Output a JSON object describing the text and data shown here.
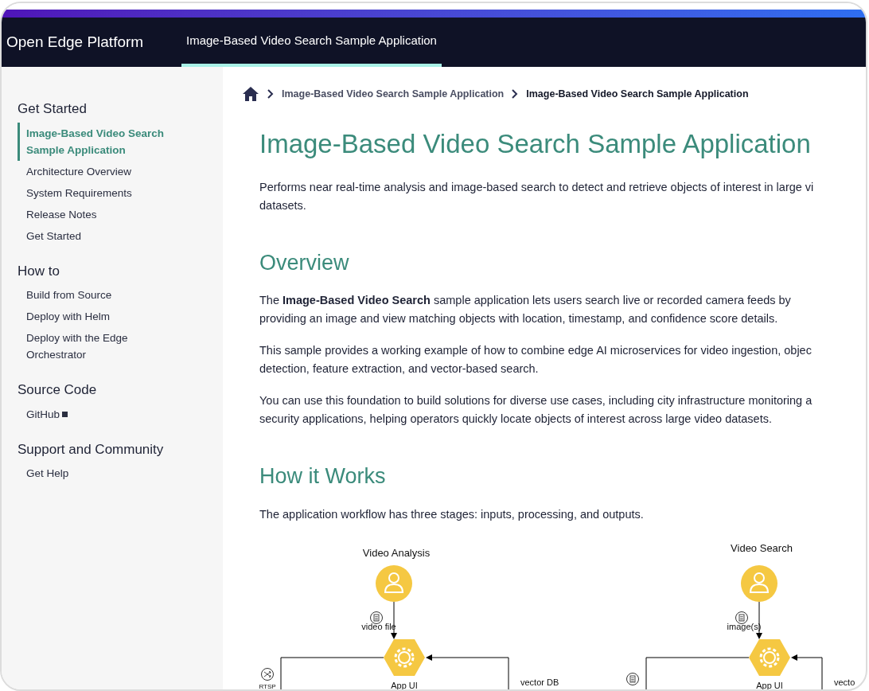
{
  "header": {
    "brand": "Open Edge Platform",
    "tabs": [
      {
        "label": "Image-Based Video Search Sample Application",
        "selected": true
      }
    ]
  },
  "sidebar": {
    "sections": [
      {
        "title": "Get Started",
        "items": [
          {
            "label": "Image-Based Video Search Sample Application",
            "selected": true,
            "external": false
          },
          {
            "label": "Architecture Overview",
            "selected": false,
            "external": false
          },
          {
            "label": "System Requirements",
            "selected": false,
            "external": false
          },
          {
            "label": "Release Notes",
            "selected": false,
            "external": false
          },
          {
            "label": "Get Started",
            "selected": false,
            "external": false
          }
        ]
      },
      {
        "title": "How to",
        "items": [
          {
            "label": "Build from Source",
            "selected": false,
            "external": false
          },
          {
            "label": "Deploy with Helm",
            "selected": false,
            "external": false
          },
          {
            "label": "Deploy with the Edge Orchestrator",
            "selected": false,
            "external": false
          }
        ]
      },
      {
        "title": "Source Code",
        "items": [
          {
            "label": "GitHub",
            "selected": false,
            "external": true
          }
        ]
      },
      {
        "title": "Support and Community",
        "items": [
          {
            "label": "Get Help",
            "selected": false,
            "external": false
          }
        ]
      }
    ]
  },
  "breadcrumb": [
    {
      "label": "Image-Based Video Search Sample Application",
      "current": false
    },
    {
      "label": "Image-Based Video Search Sample Application",
      "current": true
    }
  ],
  "content": [
    {
      "kind": "h1",
      "text": "Image-Based Video Search Sample Application"
    },
    {
      "kind": "p",
      "lines": [
        "Performs near real-time analysis and image-based search to detect and retrieve objects of interest in large vi",
        "datasets."
      ]
    },
    {
      "kind": "h2",
      "text": "Overview"
    },
    {
      "kind": "p",
      "lines": [
        "The **Image-Based Video Search** sample application lets users search live or recorded camera feeds by",
        "providing an image and view matching objects with location, timestamp, and confidence score details."
      ]
    },
    {
      "kind": "p",
      "lines": [
        "This sample provides a working example of how to combine edge AI microservices for video ingestion, objec",
        "detection, feature extraction, and vector-based search."
      ]
    },
    {
      "kind": "p",
      "lines": [
        "You can use this foundation to build solutions for diverse use cases, including city infrastructure monitoring a",
        "security applications, helping operators quickly locate objects of interest across large video datasets."
      ]
    },
    {
      "kind": "h2",
      "text": "How it Works"
    },
    {
      "kind": "p",
      "lines": [
        "The application workflow has three stages: inputs, processing, and outputs."
      ]
    }
  ],
  "diagram": {
    "panels": [
      {
        "title": "Video Analysis",
        "input_label": "video file",
        "node_label": "App UI",
        "left_port": {
          "kind": "shuffle",
          "label": "RTSP"
        },
        "right_label": "vector DB"
      },
      {
        "title": "Video Search",
        "input_label": "image(s)",
        "node_label": "App UI",
        "left_port": {
          "kind": "document"
        },
        "right_label": "vecto"
      }
    ]
  }
}
